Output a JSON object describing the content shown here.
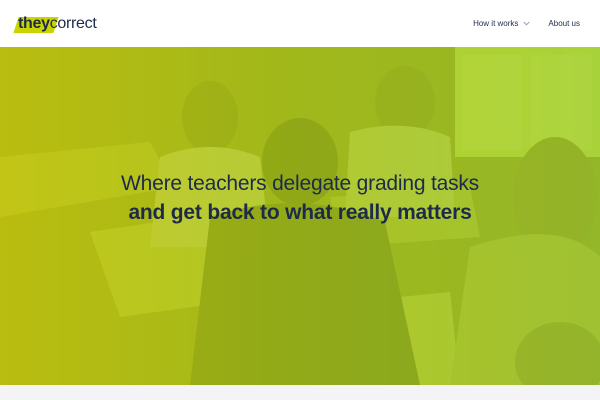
{
  "header": {
    "logo": {
      "part1": "they",
      "part2": "correct"
    },
    "nav": [
      {
        "label": "How it works",
        "has_dropdown": true
      },
      {
        "label": "About us",
        "has_dropdown": false
      }
    ]
  },
  "hero": {
    "line1": "Where teachers delegate grading tasks",
    "line2": "and get back to what really matters"
  },
  "colors": {
    "brand_navy": "#1e2a4a",
    "brand_lime": "#c9d400",
    "hero_tint": "#bcc80a"
  },
  "icons": [
    "chevron-down-icon"
  ]
}
